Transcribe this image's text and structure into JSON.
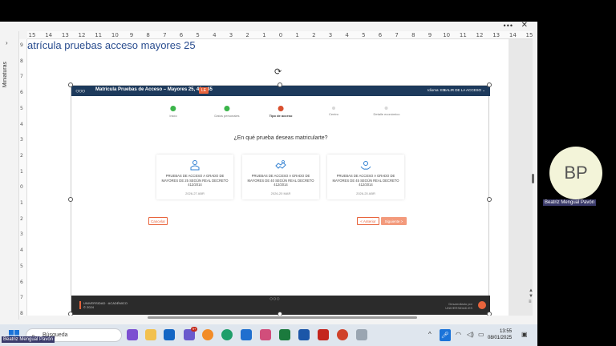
{
  "window": {
    "more_label": "•••",
    "close_label": "✕"
  },
  "left_panel": {
    "collapse_label": "›",
    "label": "Miniaturas"
  },
  "ruler": {
    "ticks": [
      "15",
      "14",
      "13",
      "12",
      "11",
      "10",
      "9",
      "8",
      "7",
      "6",
      "5",
      "4",
      "3",
      "2",
      "1",
      "0",
      "1",
      "2",
      "3",
      "4",
      "5",
      "6",
      "7",
      "8",
      "9",
      "10",
      "11",
      "12",
      "13",
      "14",
      "15"
    ]
  },
  "vruler": {
    "ticks": [
      "9",
      "8",
      "7",
      "6",
      "5",
      "4",
      "3",
      "2",
      "1",
      "0",
      "1",
      "2",
      "3",
      "4",
      "5",
      "6",
      "7",
      "8"
    ]
  },
  "slide": {
    "title": "atrícula pruebas acceso mayores 25"
  },
  "app": {
    "logo": "○○○",
    "title": "Matrícula Pruebas de Acceso – Mayores 25, 40 y 45",
    "badge": "LE",
    "user_label": "Idioma: ES",
    "access_label": "SALIR DE LA ACCESO ⌄",
    "steps": [
      {
        "label": "Inicio",
        "state": "done"
      },
      {
        "label": "Datos personales",
        "state": "done"
      },
      {
        "label": "Tipo de acceso",
        "state": "current"
      },
      {
        "label": "Centro",
        "state": "todo"
      },
      {
        "label": "Detalle económico",
        "state": "todo"
      }
    ],
    "question": "¿En qué prueba deseas matricularte?",
    "cards": [
      {
        "icon": "person-icon",
        "text": "PRUEBAS DE ACCESO A GRADO DE MAYORES DE 25 SEGÚN REAL DECRETO 412/2014",
        "date": "2026-27 ABR"
      },
      {
        "icon": "handshake-icon",
        "text": "PRUEBAS DE ACCESO A GRADO DE MAYORES DE 40 SEGÚN REAL DECRETO 412/2014",
        "date": "2026-20 MAR"
      },
      {
        "icon": "hands-icon",
        "text": "PRUEBAS DE ACCESO A GRADO DE MAYORES DE 45 SEGÚN REAL DECRETO 412/2014",
        "date": "2026-20 ABR"
      }
    ],
    "cancel_label": "Cancelar",
    "prev_label": "< Anterior",
    "next_label": "Siguiente >",
    "footer_left_1": "UNIVERSIDAD · ACADÉMICO",
    "footer_left_2": "© 2024",
    "footer_logo": "○○○",
    "footer_right_1": "Desarrollado por",
    "footer_right_2": "UNIVERSIDAD.ES"
  },
  "taskbar": {
    "search_placeholder": "Búsqueda",
    "search_icon": "search-icon",
    "notification_count": "9+",
    "time": "13:55",
    "date": "08/01/2025"
  },
  "participants": {
    "remote_initials": "BP",
    "remote_name": "Beatriz Mengual Pavón",
    "self_name": "Beatriz Mengual Pavón"
  }
}
